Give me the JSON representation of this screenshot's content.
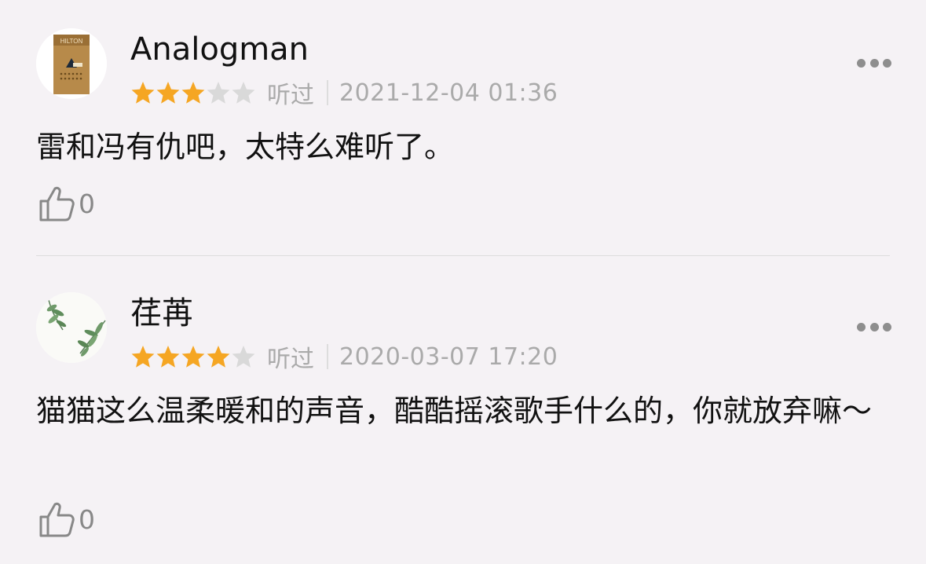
{
  "comments": [
    {
      "username": "Analogman",
      "rating": 3,
      "max_rating": 5,
      "status": "听过",
      "date": "2021-12-04 01:36",
      "text": "雷和冯有仇吧，太特么难听了。",
      "likes": "0",
      "avatar": {
        "type": "cigarette-pack",
        "brand_text": "HILTON"
      }
    },
    {
      "username": "荏苒",
      "rating": 4,
      "max_rating": 5,
      "status": "听过",
      "date": "2020-03-07 17:20",
      "text": "猫猫这么温柔暖和的声音，酷酷摇滚歌手什么的，你就放弃嘛～",
      "likes": "0",
      "avatar": {
        "type": "leaves"
      }
    }
  ],
  "colors": {
    "star_filled": "#f5a623",
    "star_empty": "#d9d9d9",
    "meta_text": "#aaaaaa",
    "background": "#f5f2f5"
  },
  "icons": [
    "more-icon",
    "thumbs-up-icon",
    "star-icon"
  ]
}
